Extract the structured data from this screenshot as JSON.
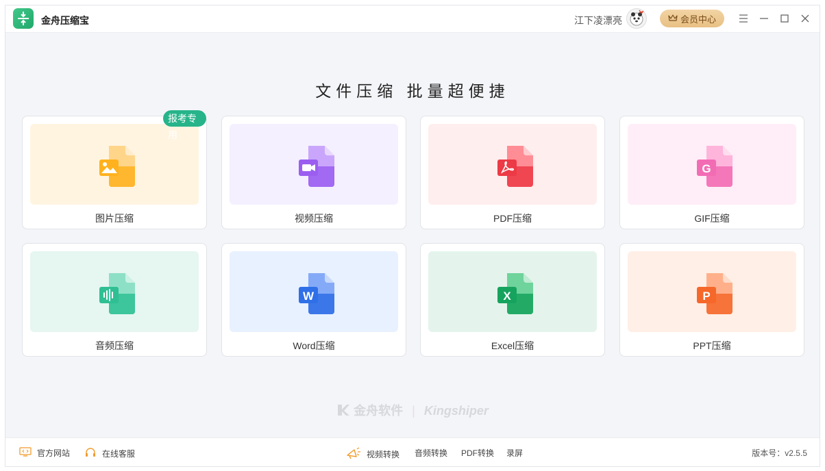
{
  "app": {
    "title": "金舟压缩宝"
  },
  "header": {
    "username": "江下凌漂亮",
    "vip_label": "会员中心"
  },
  "headline": "文件压缩 批量超便捷",
  "cards": [
    {
      "label": "图片压缩",
      "badge": "报考专用",
      "bg": "#fff4e0",
      "icon_color": "#ffb21e",
      "icon_light": "#ffd58a",
      "glyph": "picture"
    },
    {
      "label": "视频压缩",
      "bg": "#f4f0ff",
      "icon_color": "#9b5ef0",
      "icon_light": "#c9a6fb",
      "glyph": "video"
    },
    {
      "label": "PDF压缩",
      "bg": "#ffeeee",
      "icon_color": "#ec3a46",
      "icon_light": "#ff8d95",
      "glyph": "pdf"
    },
    {
      "label": "GIF压缩",
      "bg": "#ffeef7",
      "icon_color": "#f26cb4",
      "icon_light": "#ffb4db",
      "glyph": "G"
    },
    {
      "label": "音频压缩",
      "bg": "#e6f6f1",
      "icon_color": "#2fbf93",
      "icon_light": "#8de0c6",
      "glyph": "audio"
    },
    {
      "label": "Word压缩",
      "bg": "#e8f1ff",
      "icon_color": "#2f6fe8",
      "icon_light": "#84aaf7",
      "glyph": "W"
    },
    {
      "label": "Excel压缩",
      "bg": "#e4f4ec",
      "icon_color": "#16a35d",
      "icon_light": "#6fd39c",
      "glyph": "X"
    },
    {
      "label": "PPT压缩",
      "bg": "#ffefe6",
      "icon_color": "#f5682a",
      "icon_light": "#ffb08a",
      "glyph": "P"
    }
  ],
  "watermark": {
    "cn": "金舟软件",
    "en": "Kingshiper"
  },
  "footer": {
    "official_site": "官方网站",
    "online_service": "在线客服",
    "video_convert": "视频转换",
    "audio_convert": "音频转换",
    "pdf_convert": "PDF转换",
    "screen_record": "录屏",
    "version": "版本号：v2.5.5"
  }
}
